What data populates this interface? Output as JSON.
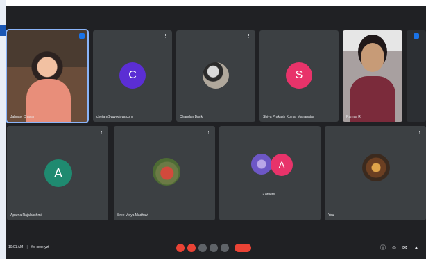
{
  "meeting": {
    "time_label": "10:01 AM",
    "code_label": "frs-xxxx-yzt",
    "more_label": "⋮"
  },
  "participants": [
    {
      "name": "Jahnavi Chavan",
      "initial": "",
      "color": "#000000"
    },
    {
      "name": "chetan@yuvodaya.com",
      "initial": "C",
      "color": "#5b2ed4"
    },
    {
      "name": "Chandan Barik",
      "initial": "",
      "color": "#000000"
    },
    {
      "name": "Shiva Prakash Kumar Mahapatra",
      "initial": "S",
      "color": "#e8336a"
    },
    {
      "name": "Ramya R",
      "initial": "",
      "color": "#000000"
    },
    {
      "name": "Aparna Rajalakshmi",
      "initial": "A",
      "color": "#1f8a70"
    },
    {
      "name": "Sree Vidya Madhavi",
      "initial": "",
      "color": "#000000"
    },
    {
      "name": "2 others",
      "initial": "A",
      "color": "#e8336a"
    },
    {
      "name": "You",
      "initial": "",
      "color": "#000000"
    }
  ],
  "controls": {
    "mic": "mic-off-icon",
    "cam": "camera-off-icon",
    "captions": "captions-icon",
    "present": "present-icon",
    "more": "more-options-icon",
    "end": "end-call-icon",
    "info": "info-icon",
    "people": "people-icon",
    "chat": "chat-icon",
    "activities": "activities-icon"
  }
}
